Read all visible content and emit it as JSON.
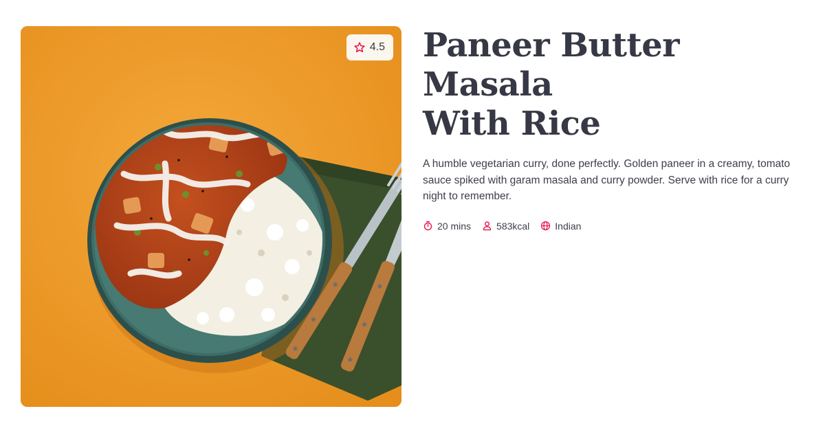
{
  "recipe": {
    "title_line1": "Paneer Butter Masala",
    "title_line2": "With Rice",
    "description": "A humble vegetarian curry, done perfectly. Golden paneer in a creamy, tomato sauce spiked with garam masala and curry powder. Serve with rice for a curry night to remember.",
    "rating": "4.5",
    "meta": {
      "time": "20 mins",
      "calories": "583kcal",
      "cuisine": "Indian"
    }
  },
  "icons": {
    "rating": "star-icon",
    "time": "stopwatch-icon",
    "calories": "person-icon",
    "cuisine": "globe-icon"
  },
  "colors": {
    "accent": "#e5134b",
    "title": "#373845",
    "text": "#3d3e4a",
    "badge_bg": "#fbf6ee"
  }
}
